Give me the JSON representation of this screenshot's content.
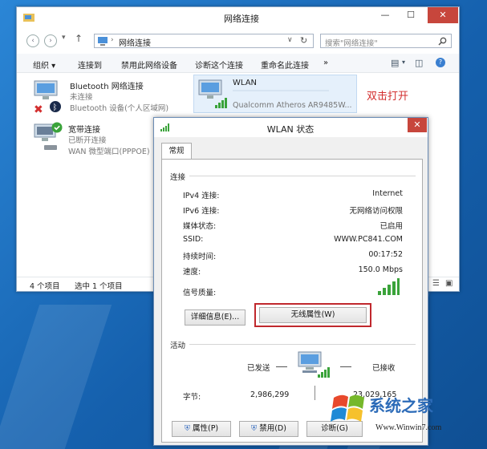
{
  "explorer": {
    "title": "网络连接",
    "breadcrumb": "网络连接",
    "search_placeholder": "搜索\"网络连接\"",
    "toolbar": {
      "organize": "组织 ▾",
      "connect_to": "连接到",
      "disable_device": "禁用此网络设备",
      "diagnose": "诊断这个连接",
      "rename": "重命名此连接",
      "more": "»"
    },
    "connections": [
      {
        "name": "Bluetooth 网络连接",
        "status": "未连接",
        "device": "Bluetooth 设备(个人区域网)"
      },
      {
        "name": "WLAN",
        "status": "",
        "device": "Qualcomm Atheros AR9485W..."
      },
      {
        "name": "宽带连接",
        "status": "已断开连接",
        "device": "WAN 微型端口(PPPOE)"
      }
    ],
    "status_bar": {
      "item_count": "4 个项目",
      "selected": "选中 1 个项目"
    }
  },
  "annotation": {
    "double_click": "双击打开"
  },
  "dialog": {
    "title": "WLAN 状态",
    "tab": "常规",
    "connection_group": "连接",
    "rows": [
      {
        "label": "IPv4 连接:",
        "value": "Internet"
      },
      {
        "label": "IPv6 连接:",
        "value": "无网络访问权限"
      },
      {
        "label": "媒体状态:",
        "value": "已启用"
      },
      {
        "label": "SSID:",
        "value": "WWW.PC841.COM"
      },
      {
        "label": "持续时间:",
        "value": "00:17:52"
      },
      {
        "label": "速度:",
        "value": "150.0 Mbps"
      }
    ],
    "signal_label": "信号质量:",
    "details_button": "详细信息(E)...",
    "wireless_props_button": "无线属性(W)",
    "activity_group": "活动",
    "sent_label": "已发送",
    "received_label": "已接收",
    "bytes_label": "字节:",
    "bytes_sent": "2,986,299",
    "bytes_received": "23,029,165",
    "properties_button": "属性(P)",
    "disable_button": "禁用(D)",
    "diagnose_button": "诊断(G)"
  },
  "watermark": {
    "brand": "系统之家",
    "url": "Www.Winwin7.com"
  },
  "colors": {
    "highlight": "#c0282d",
    "signal_green": "#3aa33a",
    "selection": "#e5f0fb"
  }
}
